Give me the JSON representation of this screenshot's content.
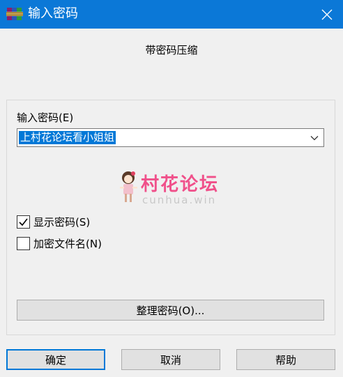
{
  "window": {
    "title": "输入密码"
  },
  "subtitle": "带密码压缩",
  "password": {
    "label": "输入密码(E)",
    "value": "上村花论坛看小姐姐"
  },
  "watermark": {
    "text": "村花论坛",
    "url": "cunhua.win"
  },
  "checkboxes": [
    {
      "label": "显示密码(S)",
      "checked": true
    },
    {
      "label": "加密文件名(N)",
      "checked": false
    }
  ],
  "buttons": {
    "organize": "整理密码(O)...",
    "ok": "确定",
    "cancel": "取消",
    "help": "帮助"
  },
  "colors": {
    "titlebar": "#0b78d7",
    "selection": "#0078d7",
    "watermark": "#f0508a"
  }
}
